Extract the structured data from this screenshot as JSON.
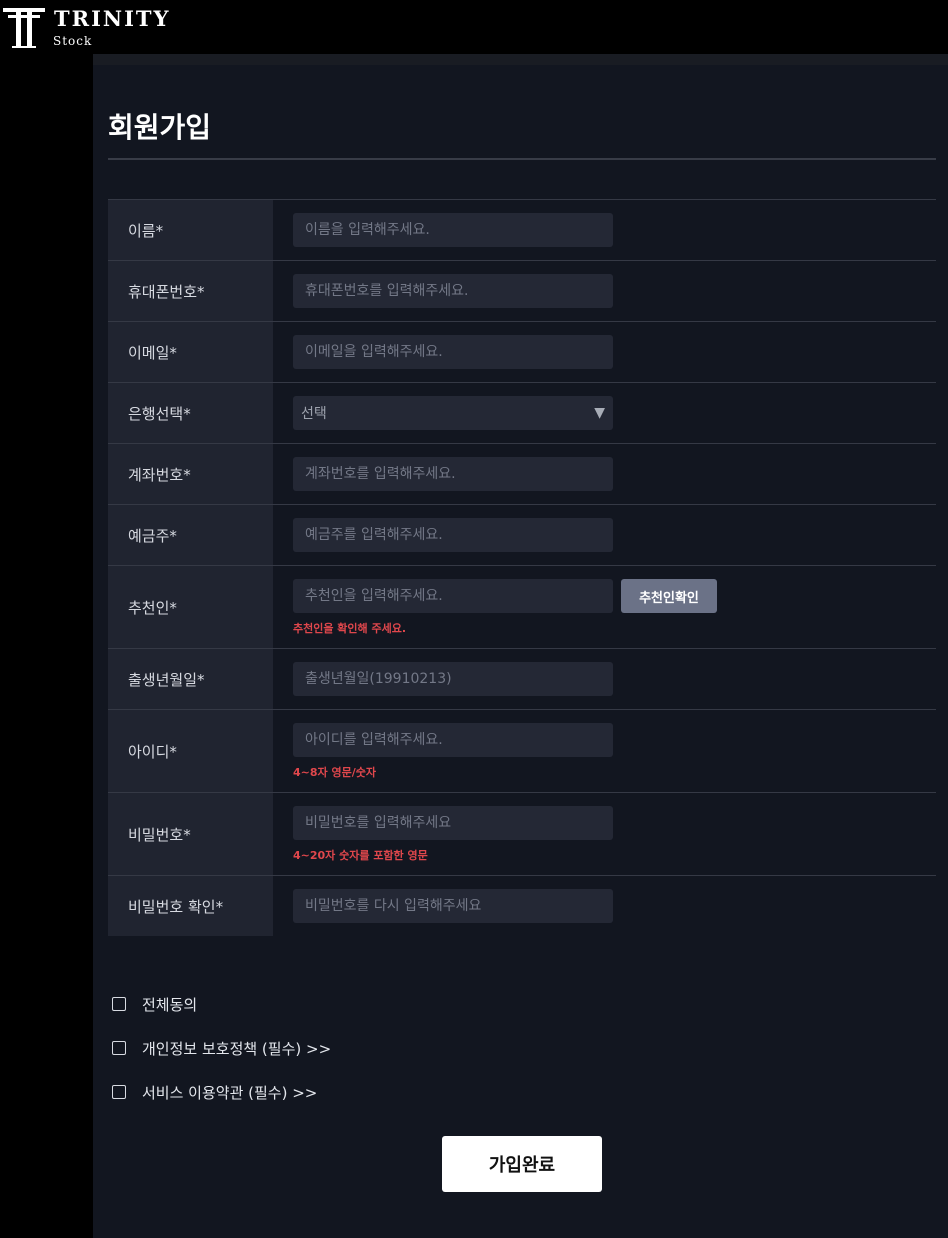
{
  "brand": {
    "name": "TRINITY",
    "sub": "Stock"
  },
  "page_title": "회원가입",
  "fields": [
    {
      "label": "이름*",
      "placeholder": "이름을 입력해주세요."
    },
    {
      "label": "휴대폰번호*",
      "placeholder": "휴대폰번호를 입력해주세요."
    },
    {
      "label": "이메일*",
      "placeholder": "이메일을 입력해주세요."
    },
    {
      "label": "은행선택*",
      "value": "선택"
    },
    {
      "label": "계좌번호*",
      "placeholder": "계좌번호를 입력해주세요."
    },
    {
      "label": "예금주*",
      "placeholder": "예금주를 입력해주세요."
    },
    {
      "label": "추천인*",
      "placeholder": "추천인을 입력해주세요.",
      "button": "추천인확인",
      "hint": "추천인을 확인해 주세요."
    },
    {
      "label": "출생년월일*",
      "placeholder": "출생년월일(19910213)"
    },
    {
      "label": "아이디*",
      "placeholder": "아이디를 입력해주세요.",
      "hint": "4~8자 영문/숫자"
    },
    {
      "label": "비밀번호*",
      "placeholder": "비밀번호를 입력해주세요",
      "hint": "4~20자 숫자를 포함한 영문"
    },
    {
      "label": "비밀번호 확인*",
      "placeholder": "비밀번호를 다시 입력해주세요"
    }
  ],
  "agreements": [
    {
      "label": "전체동의",
      "checked": false
    },
    {
      "label": "개인정보 보호정책 (필수) >>",
      "checked": false
    },
    {
      "label": "서비스 이용약관 (필수) >>",
      "checked": false
    }
  ],
  "submit_label": "가입완료",
  "colors": {
    "background": "#121620",
    "label_bg": "#202430",
    "input_bg": "#242835",
    "hint": "#e0474c",
    "button": "#6b7287"
  },
  "icons": {
    "logo": "trinity-t-logo",
    "select": "triangle-down-icon"
  }
}
